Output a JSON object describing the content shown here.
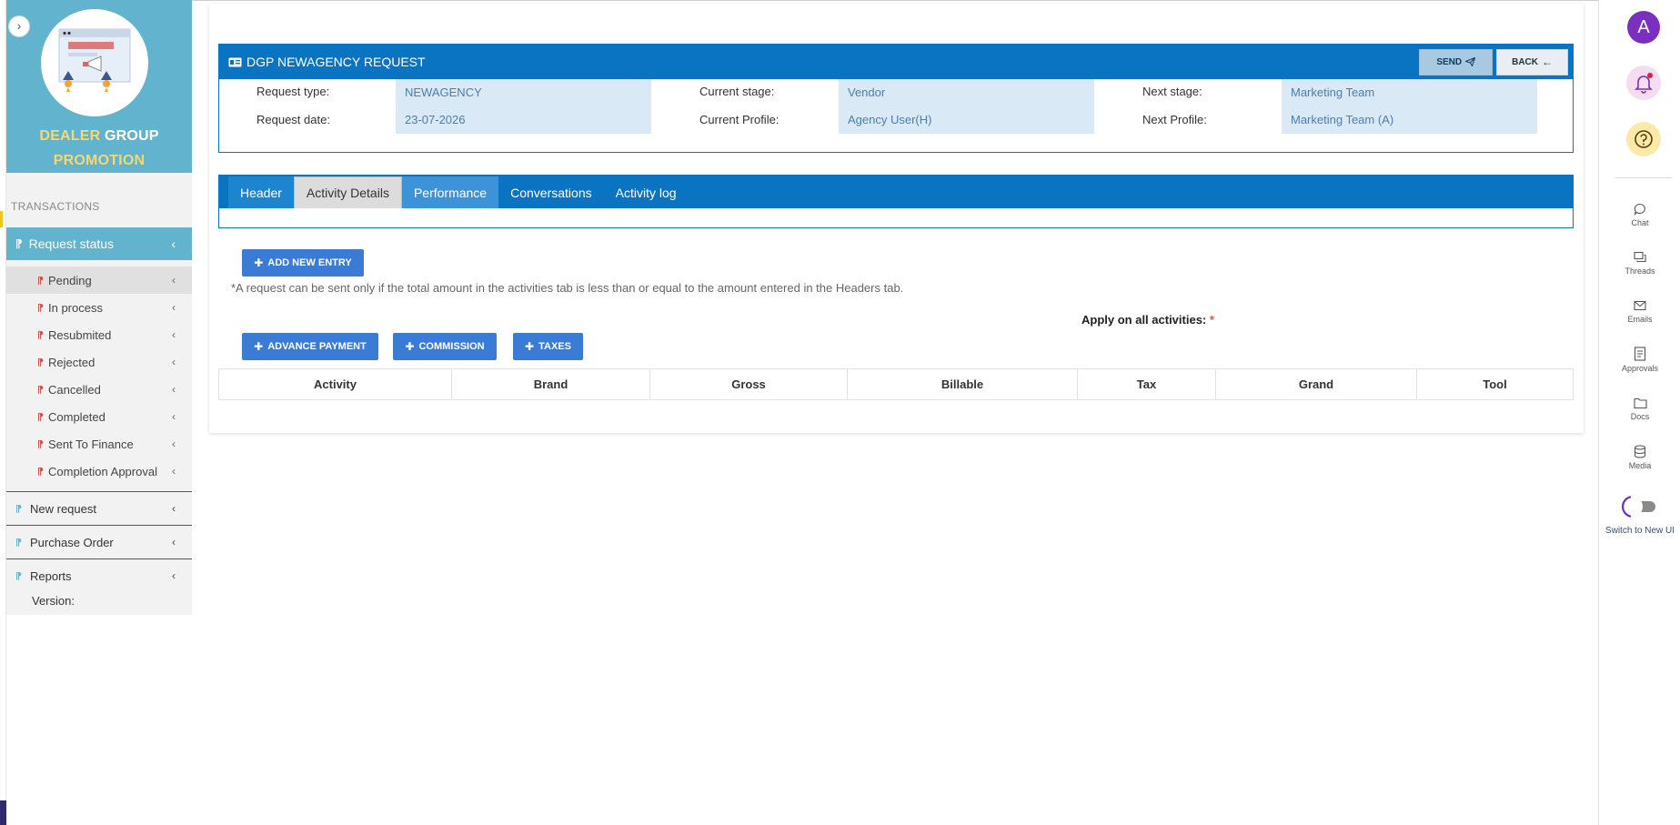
{
  "brand": {
    "line1_yellow": "DEALER",
    "line1_white": "GROUP",
    "line2": "PROMOTION"
  },
  "sidebar": {
    "section_label": "TRANSACTIONS",
    "request_status": "Request status",
    "sub_items": [
      "Pending",
      "In process",
      "Resubmited",
      "Rejected",
      "Cancelled",
      "Completed",
      "Sent To Finance",
      "Completion Approval"
    ],
    "groups": [
      "New request",
      "Purchase Order",
      "Reports"
    ],
    "version": "Version:"
  },
  "request": {
    "title": "DGP NEWAGENCY REQUEST",
    "send_label": "SEND",
    "back_label": "BACK",
    "request_type_label": "Request type:",
    "request_type": "NEWAGENCY",
    "request_date_label": "Request date:",
    "request_date": "23-07-2026",
    "current_stage_label": "Current stage:",
    "current_stage": "Vendor",
    "current_profile_label": "Current Profile:",
    "current_profile": "Agency User(H)",
    "next_stage_label": "Next stage:",
    "next_stage": "Marketing Team",
    "next_profile_label": "Next Profile:",
    "next_profile": "Marketing Team (A)"
  },
  "tabs": [
    "Header",
    "Activity Details",
    "Performance",
    "Conversations",
    "Activity log"
  ],
  "activity": {
    "add_entry": "ADD NEW ENTRY",
    "note": "*A request can be sent only if the total amount in the activities tab is less than or equal to the amount entered in the Headers tab.",
    "apply_label": "Apply on all activities:",
    "apply_star": "*",
    "advance_payment": "ADVANCE PAYMENT",
    "commission": "COMMISSION",
    "taxes": "TAXES"
  },
  "table": {
    "columns": [
      "Activity",
      "Brand",
      "Gross",
      "Billable",
      "Tax",
      "Grand",
      "Tool"
    ]
  },
  "rail": {
    "avatar_letter": "A",
    "items": [
      "Chat",
      "Threads",
      "Emails",
      "Approvals",
      "Docs",
      "Media"
    ],
    "switch_label": "Switch to New UI"
  },
  "colors": {
    "primary": "#0a74c2",
    "sidebar_accent": "#62b3cd",
    "button_blue": "#3a7bd5",
    "avatar": "#7b2fbf"
  }
}
